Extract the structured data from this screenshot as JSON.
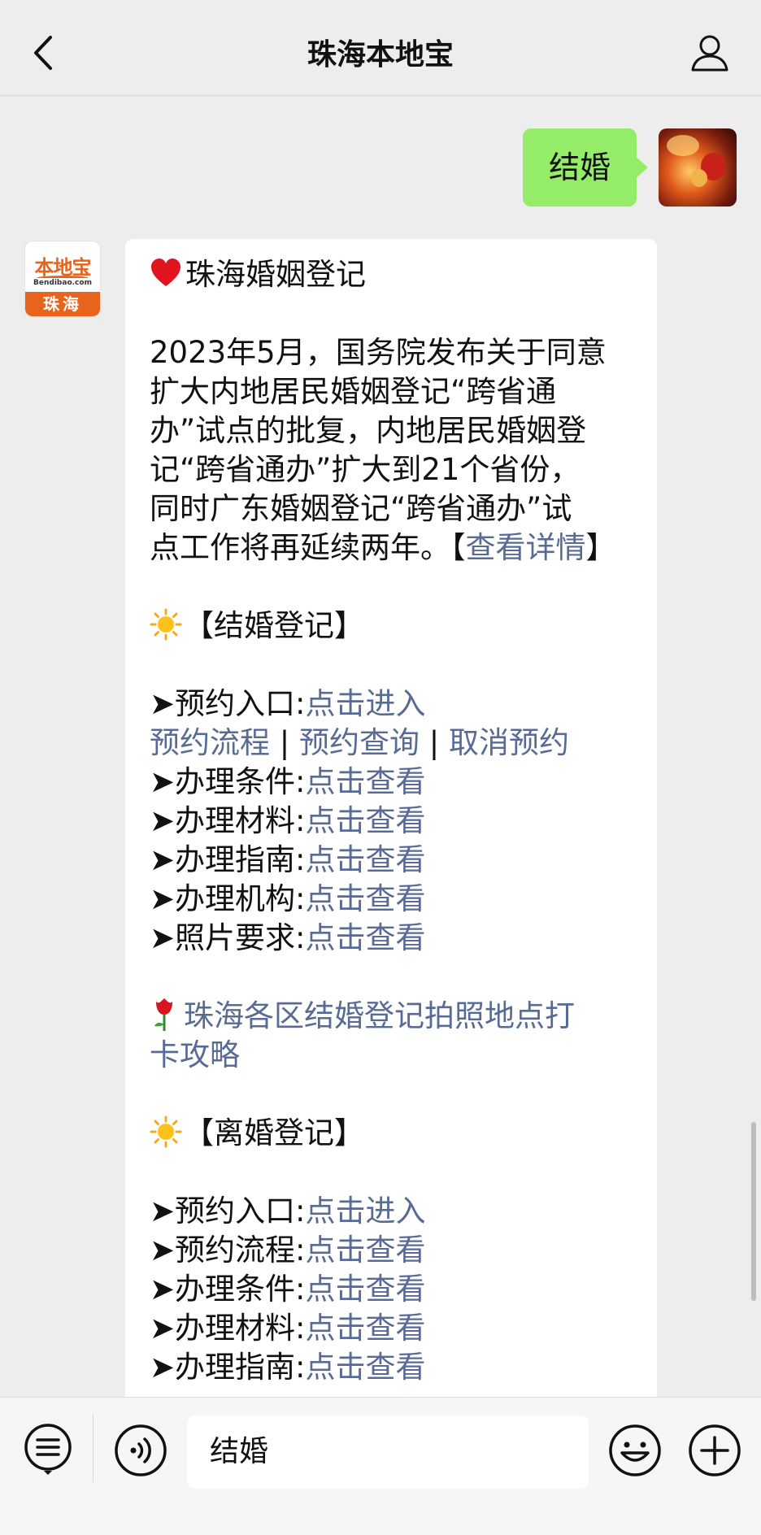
{
  "header": {
    "title": "珠海本地宝",
    "back_icon": "chevron-left-icon",
    "profile_icon": "user-icon"
  },
  "outgoing": {
    "text": "结婚"
  },
  "bot": {
    "avatar_logo": "本地宝",
    "avatar_domain": "Bendibao.com",
    "avatar_city": "珠海"
  },
  "message": {
    "heading": "珠海婚姻登记",
    "intro": [
      "2023年5月，国务院发布关于同意",
      "扩大内地居民婚姻登记“跨省通",
      "办”试点的批复，内地居民婚姻登",
      "记“跨省通办”扩大到21个省份，",
      "同时广东婚姻登记“跨省通办”试"
    ],
    "intro_last_prefix": "点工作将再延续两年。【",
    "intro_last_link": "查看详情",
    "intro_last_suffix": "】",
    "marriage_section": "【结婚登记】",
    "marriage_entry_label": "➤预约入口:",
    "marriage_entry_link": "点击进入",
    "marriage_flow": "预约流程",
    "marriage_query": "预约查询",
    "marriage_cancel": "取消预约",
    "separator": "|",
    "marriage_items": [
      {
        "label": "➤办理条件:",
        "link": "点击查看"
      },
      {
        "label": "➤办理材料:",
        "link": "点击查看"
      },
      {
        "label": "➤办理指南:",
        "link": "点击查看"
      },
      {
        "label": "➤办理机构:",
        "link": "点击查看"
      },
      {
        "label": "➤照片要求:",
        "link": "点击查看"
      }
    ],
    "photo_guide_line1": "珠海各区结婚登记拍照地点打",
    "photo_guide_line2": "卡攻略",
    "divorce_section": "【离婚登记】",
    "divorce_items": [
      {
        "label": "➤预约入口:",
        "link": "点击进入"
      },
      {
        "label": "➤预约流程:",
        "link": "点击查看"
      },
      {
        "label": "➤办理条件:",
        "link": "点击查看"
      },
      {
        "label": "➤办理材料:",
        "link": "点击查看"
      },
      {
        "label": "➤办理指南:",
        "link": "点击查看"
      }
    ],
    "link_color": "#576b95"
  },
  "input_bar": {
    "menu_icon": "menu-list-icon",
    "voice_icon": "voice-icon",
    "input_value": "结婚",
    "emoji_icon": "emoji-icon",
    "plus_icon": "plus-icon"
  },
  "colors": {
    "outgoing_bubble": "#95ec69",
    "background": "#ededed",
    "brand_orange": "#e8631b"
  }
}
